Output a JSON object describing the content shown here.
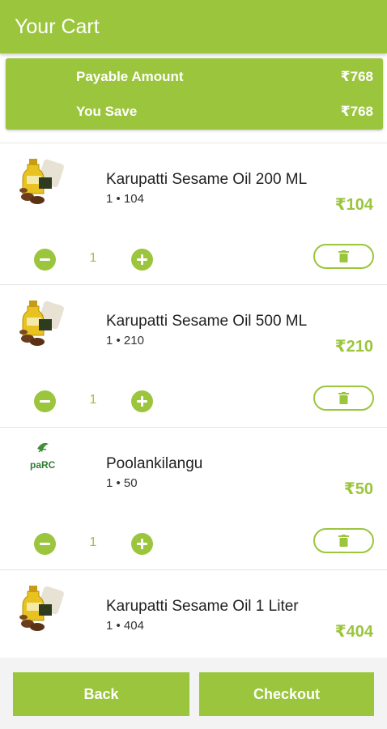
{
  "header": {
    "title": "Your Cart"
  },
  "summary": {
    "payable_label": "Payable Amount",
    "payable_value": "₹768",
    "save_label": "You Save",
    "save_value": "₹768"
  },
  "items": [
    {
      "name": "Karupatti Sesame Oil 200 ML",
      "qty_price": "1 • 104",
      "total": "₹104",
      "qty": "1",
      "thumb": "sesame-oil-product-icon"
    },
    {
      "name": "Karupatti Sesame Oil 500 ML",
      "qty_price": "1 • 210",
      "total": "₹210",
      "qty": "1",
      "thumb": "sesame-oil-product-icon"
    },
    {
      "name": "Poolankilangu",
      "qty_price": "1 • 50",
      "total": "₹50",
      "qty": "1",
      "thumb": "parc-logo"
    },
    {
      "name": "Karupatti Sesame Oil 1 Liter",
      "qty_price": "1 • 404",
      "total": "₹404",
      "qty": "1",
      "thumb": "sesame-oil-product-icon"
    }
  ],
  "footer": {
    "back_label": "Back",
    "checkout_label": "Checkout"
  },
  "colors": {
    "accent": "#9bc53d",
    "text": "#222222"
  }
}
